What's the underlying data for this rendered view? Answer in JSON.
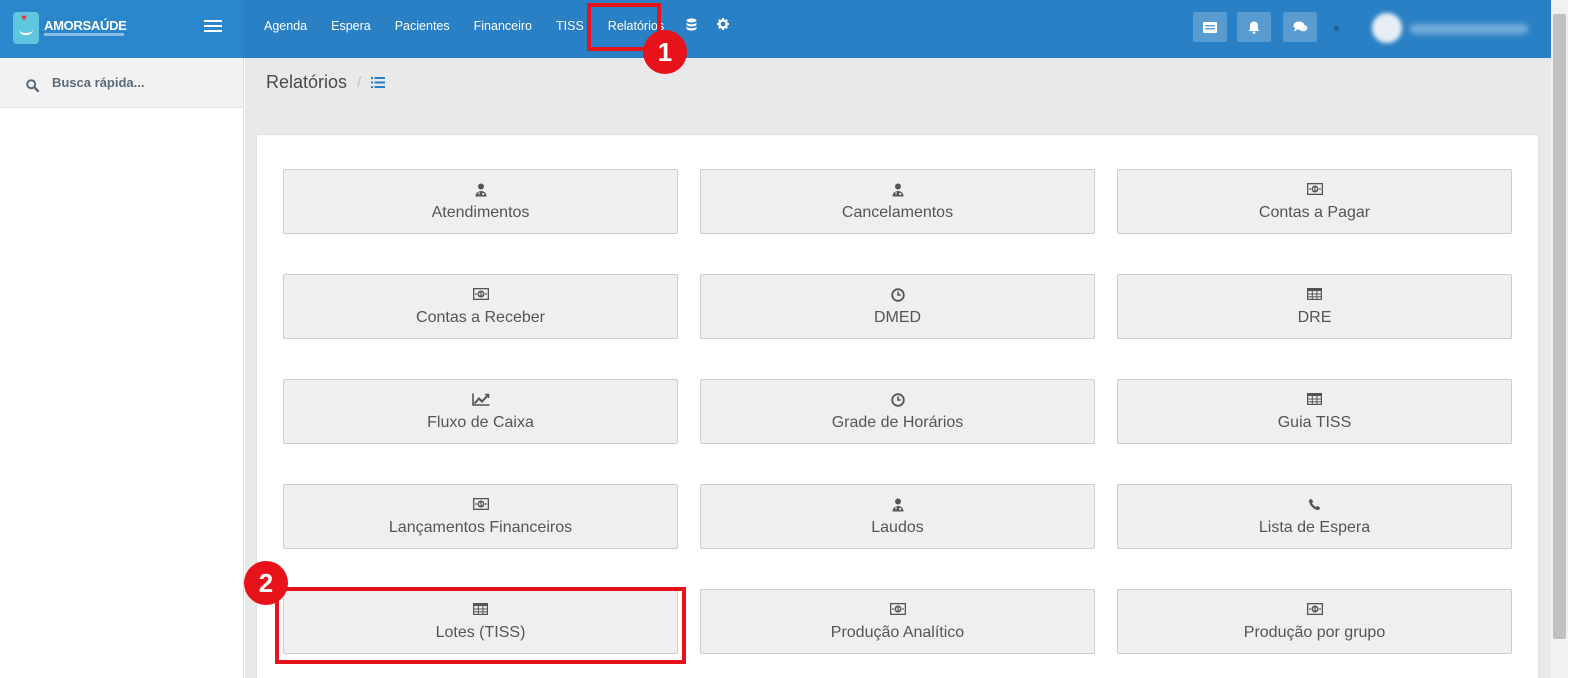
{
  "brand": {
    "name": "AMORSAÚDE"
  },
  "nav": {
    "items": [
      "Agenda",
      "Espera",
      "Pacientes",
      "Financeiro",
      "TISS",
      "Relatórios"
    ],
    "extra_icons": [
      "database-icon",
      "gear-icon"
    ]
  },
  "topbar": {
    "buttons": [
      "cards-icon",
      "bell-icon",
      "chat-icon"
    ]
  },
  "sidebar": {
    "search_placeholder": "Busca rápida..."
  },
  "breadcrumb": {
    "title": "Relatórios",
    "separator": "/"
  },
  "reports": [
    {
      "label": "Atendimentos",
      "icon": "doctor-icon"
    },
    {
      "label": "Cancelamentos",
      "icon": "doctor-icon"
    },
    {
      "label": "Contas a Pagar",
      "icon": "money-icon"
    },
    {
      "label": "Contas a Receber",
      "icon": "money-icon"
    },
    {
      "label": "DMED",
      "icon": "clock-icon"
    },
    {
      "label": "DRE",
      "icon": "table-icon"
    },
    {
      "label": "Fluxo de Caixa",
      "icon": "chart-line-icon"
    },
    {
      "label": "Grade de Horários",
      "icon": "clock-icon"
    },
    {
      "label": "Guia TISS",
      "icon": "table-icon"
    },
    {
      "label": "Lançamentos Financeiros",
      "icon": "money-icon"
    },
    {
      "label": "Laudos",
      "icon": "doctor-icon"
    },
    {
      "label": "Lista de Espera",
      "icon": "phone-icon"
    },
    {
      "label": "Lotes (TISS)",
      "icon": "table-icon"
    },
    {
      "label": "Produção Analítico",
      "icon": "money-icon"
    },
    {
      "label": "Produção por grupo",
      "icon": "money-icon"
    }
  ],
  "annotations": [
    {
      "number": "1",
      "target": "Relatórios"
    },
    {
      "number": "2",
      "target": "Lotes (TISS)"
    }
  ],
  "colors": {
    "topbar": "#2a80c4",
    "logo_area": "#2a87cc",
    "annotation": "#e8121b",
    "card_bg": "#efefef",
    "content_bg": "#e9e9e9"
  }
}
